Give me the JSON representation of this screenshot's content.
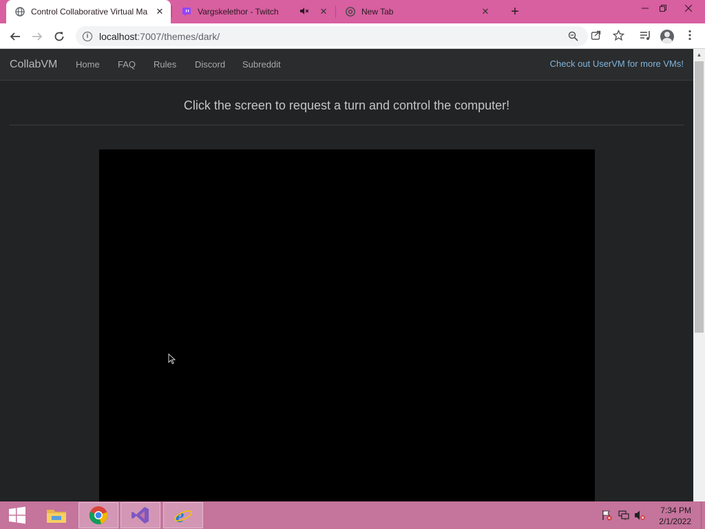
{
  "browser": {
    "tabs": [
      {
        "title": "Control Collaborative Virtual Ma",
        "active": true,
        "favicon": "globe-icon"
      },
      {
        "title": "Vargskelethor - Twitch",
        "muted": true,
        "favicon": "twitch-icon"
      },
      {
        "title": "New Tab",
        "favicon": "chrome-icon"
      }
    ],
    "new_tab_label": "+",
    "url_host": "localhost",
    "url_rest": ":7007/themes/dark/",
    "accent": "#d85fa0"
  },
  "site": {
    "brand": "CollabVM",
    "nav": [
      "Home",
      "FAQ",
      "Rules",
      "Discord",
      "Subreddit"
    ],
    "promo": "Check out UserVM for more VMs!",
    "headline": "Click the screen to request a turn and control the computer!"
  },
  "taskbar": {
    "time": "7:34 PM",
    "date": "2/1/2022",
    "color": "#c5749c",
    "apps": [
      "file-explorer-icon",
      "chrome-icon",
      "visual-studio-icon",
      "internet-explorer-icon"
    ]
  }
}
